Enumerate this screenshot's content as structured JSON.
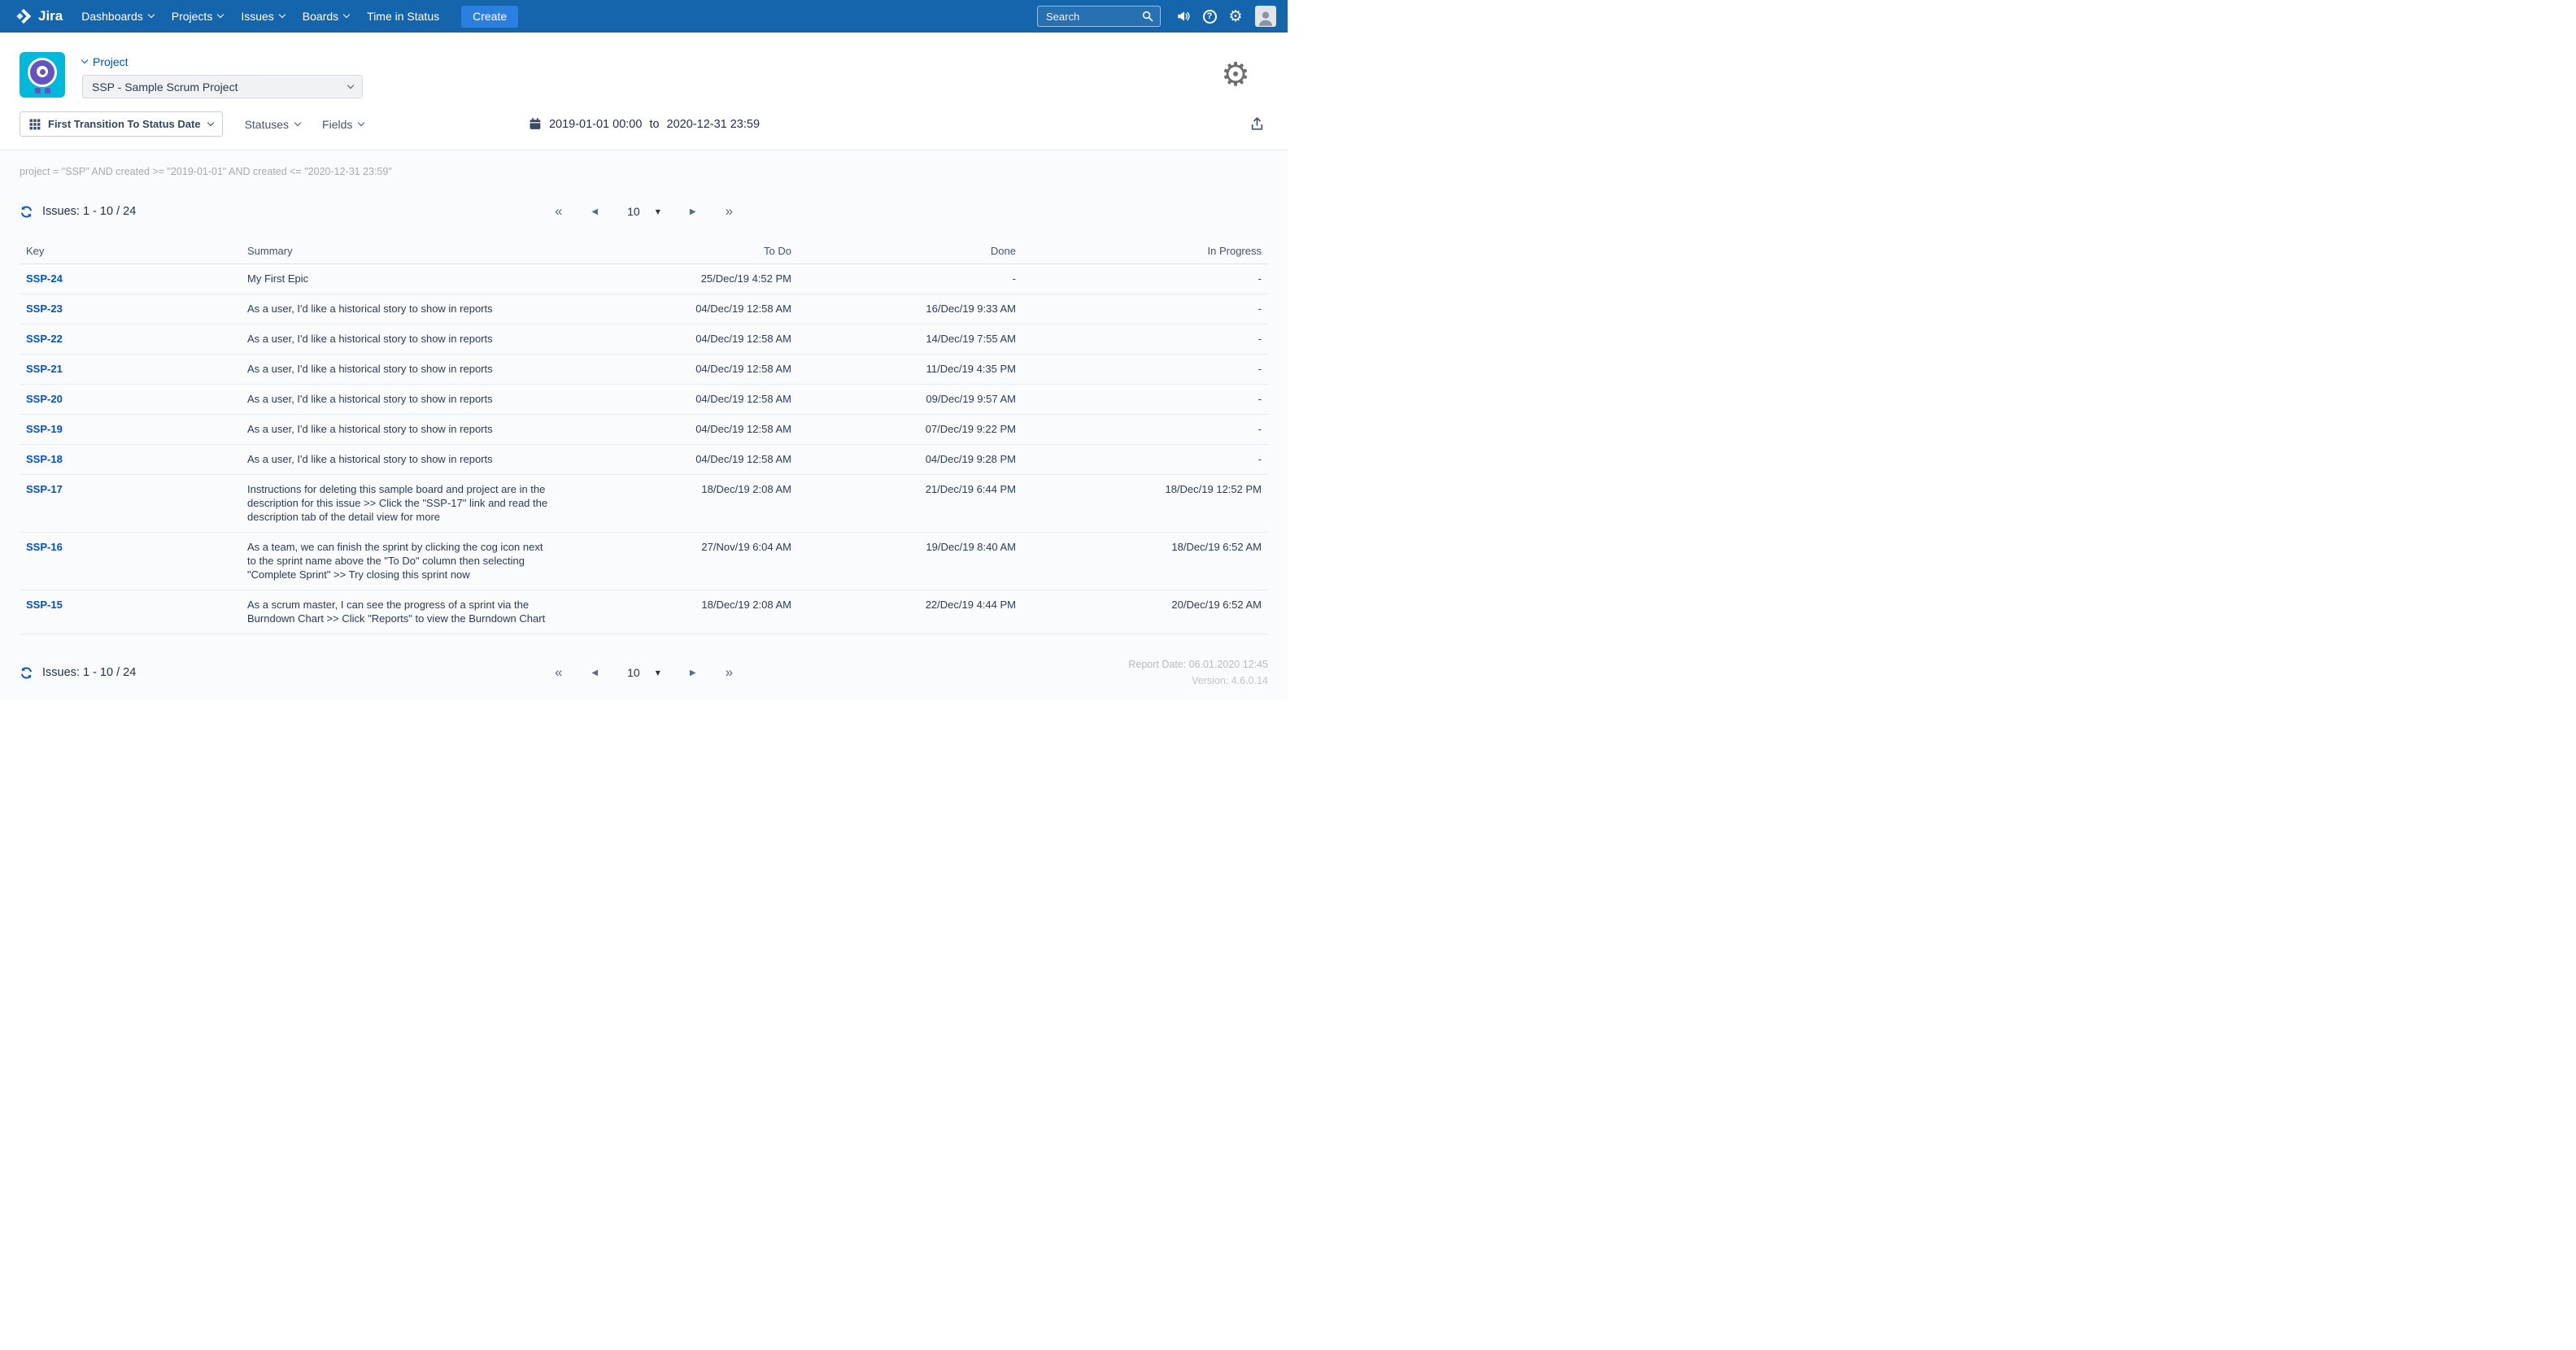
{
  "colors": {
    "navbar": "#1565ad",
    "accent": "#0052CC",
    "create_button": "#2b7fe0",
    "project_avatar_bg": "#00b8d9",
    "project_avatar_fg": "#6554C0"
  },
  "navbar": {
    "brand": "Jira",
    "items": [
      {
        "label": "Dashboards"
      },
      {
        "label": "Projects"
      },
      {
        "label": "Issues"
      },
      {
        "label": "Boards"
      },
      {
        "label": "Time in Status"
      }
    ],
    "create_label": "Create",
    "search_placeholder": "Search"
  },
  "header": {
    "project_label": "Project",
    "project_select_value": "SSP - Sample Scrum Project"
  },
  "toolbar": {
    "report_type": "First Transition To Status Date",
    "statuses_label": "Statuses",
    "fields_label": "Fields",
    "date_from": "2019-01-01 00:00",
    "date_separator": "to",
    "date_to": "2020-12-31 23:59"
  },
  "query": "project = \"SSP\" AND created >= \"2019-01-01\" AND created <= \"2020-12-31 23:59\"",
  "pagination": {
    "issues_label": "Issues: 1 - 10 / 24",
    "page_size": "10"
  },
  "icons": {
    "first_page": "«",
    "prev_page": "◀",
    "next_page": "▶",
    "last_page": "»",
    "select_caret": "▼",
    "gear": "⚙"
  },
  "table": {
    "columns": [
      "Key",
      "Summary",
      "To Do",
      "Done",
      "In Progress"
    ],
    "rows": [
      {
        "key": "SSP-24",
        "summary": "My First Epic",
        "todo": "25/Dec/19 4:52 PM",
        "done": "-",
        "inprogress": "-"
      },
      {
        "key": "SSP-23",
        "summary": "As a user, I'd like a historical story to show in reports",
        "todo": "04/Dec/19 12:58 AM",
        "done": "16/Dec/19 9:33 AM",
        "inprogress": "-"
      },
      {
        "key": "SSP-22",
        "summary": "As a user, I'd like a historical story to show in reports",
        "todo": "04/Dec/19 12:58 AM",
        "done": "14/Dec/19 7:55 AM",
        "inprogress": "-"
      },
      {
        "key": "SSP-21",
        "summary": "As a user, I'd like a historical story to show in reports",
        "todo": "04/Dec/19 12:58 AM",
        "done": "11/Dec/19 4:35 PM",
        "inprogress": "-"
      },
      {
        "key": "SSP-20",
        "summary": "As a user, I'd like a historical story to show in reports",
        "todo": "04/Dec/19 12:58 AM",
        "done": "09/Dec/19 9:57 AM",
        "inprogress": "-"
      },
      {
        "key": "SSP-19",
        "summary": "As a user, I'd like a historical story to show in reports",
        "todo": "04/Dec/19 12:58 AM",
        "done": "07/Dec/19 9:22 PM",
        "inprogress": "-"
      },
      {
        "key": "SSP-18",
        "summary": "As a user, I'd like a historical story to show in reports",
        "todo": "04/Dec/19 12:58 AM",
        "done": "04/Dec/19 9:28 PM",
        "inprogress": "-"
      },
      {
        "key": "SSP-17",
        "summary": "Instructions for deleting this sample board and project are in the description for this issue >> Click the \"SSP-17\" link and read the description tab of the detail view for more",
        "todo": "18/Dec/19 2:08 AM",
        "done": "21/Dec/19 6:44 PM",
        "inprogress": "18/Dec/19 12:52 PM"
      },
      {
        "key": "SSP-16",
        "summary": "As a team, we can finish the sprint by clicking the cog icon next to the sprint name above the \"To Do\" column then selecting \"Complete Sprint\" >> Try closing this sprint now",
        "todo": "27/Nov/19 6:04 AM",
        "done": "19/Dec/19 8:40 AM",
        "inprogress": "18/Dec/19 6:52 AM"
      },
      {
        "key": "SSP-15",
        "summary": "As a scrum master, I can see the progress of a sprint via the Burndown Chart >> Click \"Reports\" to view the Burndown Chart",
        "todo": "18/Dec/19 2:08 AM",
        "done": "22/Dec/19 4:44 PM",
        "inprogress": "20/Dec/19 6:52 AM"
      }
    ]
  },
  "footer": {
    "report_date": "Report Date: 06.01.2020 12:45",
    "version": "Version: 4.6.0.14"
  }
}
